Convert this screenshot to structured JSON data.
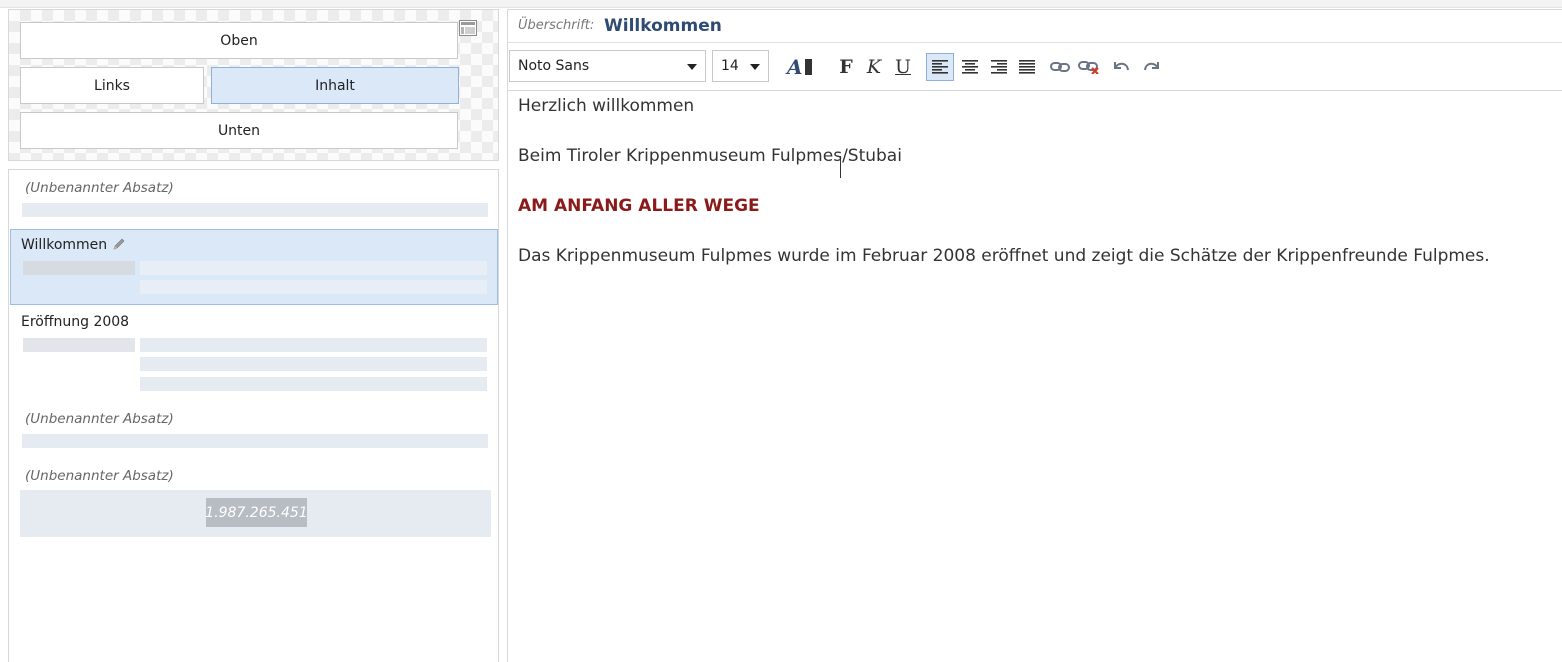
{
  "layout": {
    "oben": "Oben",
    "links": "Links",
    "inhalt": "Inhalt",
    "unten": "Unten"
  },
  "paragraphs": {
    "unnamed_1": "(Unbenannter Absatz)",
    "willkommen": "Willkommen",
    "eroeffnung": "Eröffnung 2008",
    "unnamed_2": "(Unbenannter Absatz)",
    "unnamed_3": "(Unbenannter Absatz)",
    "number": "1.987.265.451"
  },
  "editor": {
    "heading_label": "Überschrift:",
    "heading_value": "Willkommen",
    "font": "Noto Sans",
    "size": "14",
    "lines": {
      "line1": "Herzlich willkommen",
      "line2": "Beim Tiroler Krippenmuseum Fulpmes/Stubai",
      "line3": "AM ANFANG ALLER WEGE",
      "line4": "Das Krippenmuseum Fulpmes wurde im Februar 2008 eröffnet und zeigt die Schätze der Krippenfreunde Fulpmes."
    }
  },
  "toolbar": {
    "bold": "F",
    "italic": "K",
    "underline": "U"
  },
  "colors": {
    "accent_heading": "#2f4b73",
    "highlight_red": "#8b1a1a",
    "selected_bg": "#dbe8f8"
  }
}
